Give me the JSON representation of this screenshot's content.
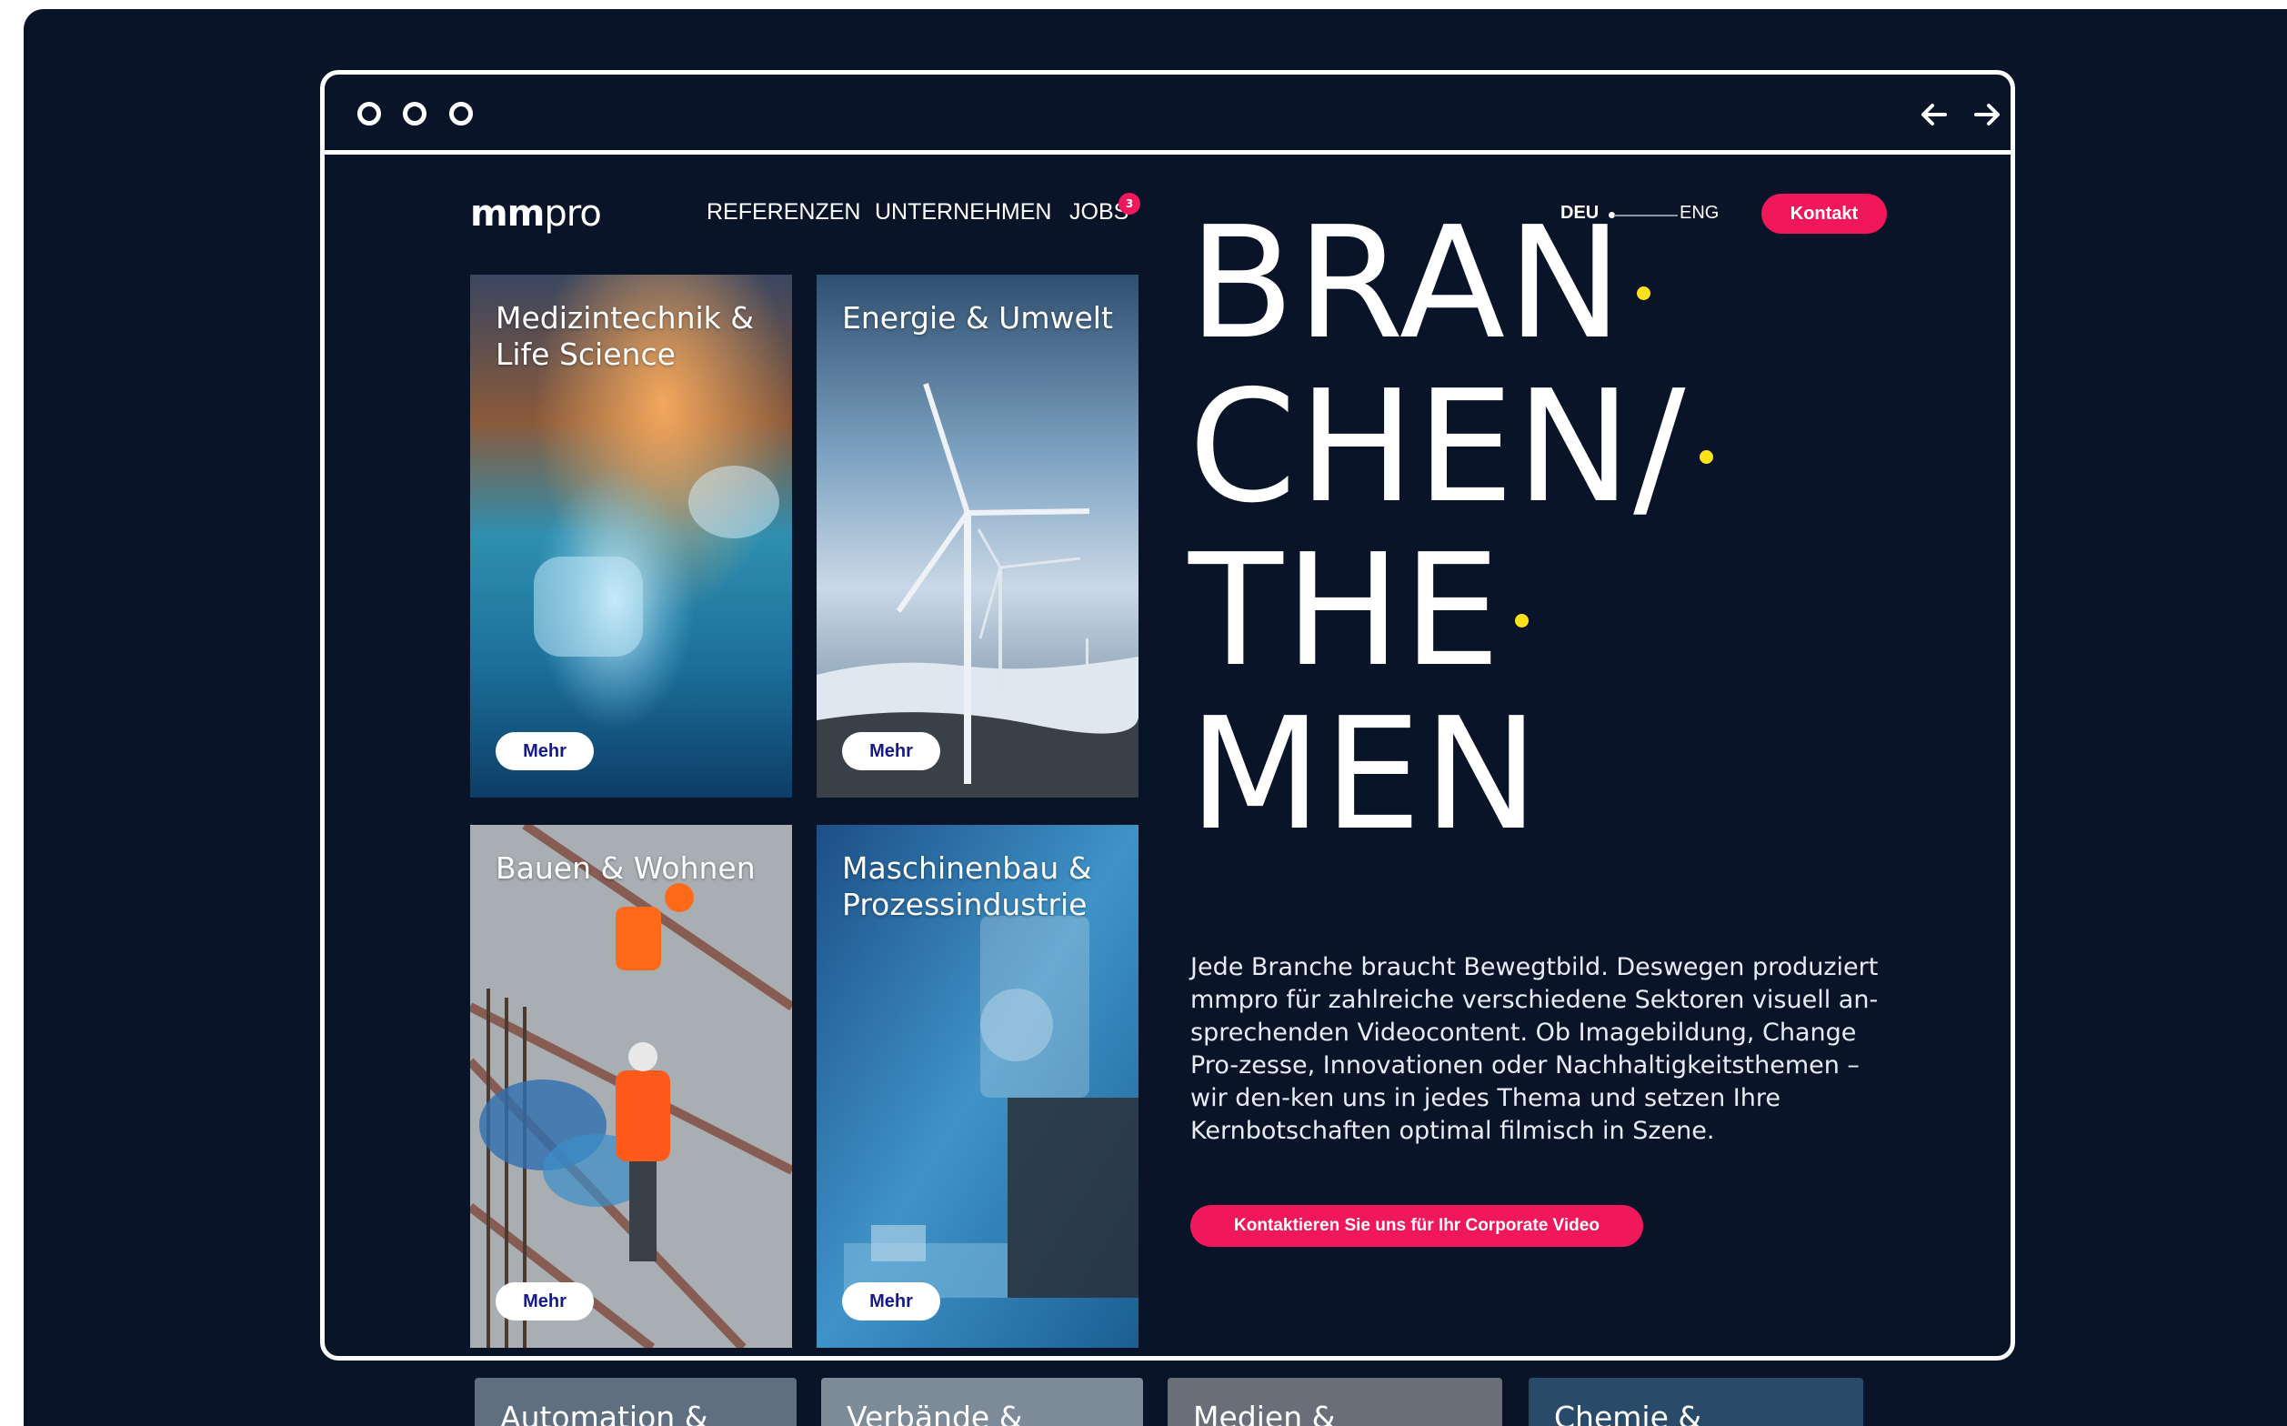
{
  "nav": {
    "logo_light": "mm",
    "logo_rest": "pro",
    "menu": [
      "REFERENZEN",
      "UNTERNEHMEN",
      "JOBS"
    ],
    "jobs_badge": "3",
    "lang_active": "DEU",
    "lang_other": "ENG",
    "contact_label": "Kontakt"
  },
  "cards": [
    {
      "title": "Medizintechnik &\nLife Science",
      "button": "Mehr"
    },
    {
      "title": "Energie & Umwelt",
      "button": "Mehr"
    },
    {
      "title": "Bauen & Wohnen",
      "button": "Mehr"
    },
    {
      "title": "Maschinenbau &\nProzessindustrie",
      "button": "Mehr"
    }
  ],
  "peek_cards": [
    "Automation &",
    "Verbände &",
    "Medien &",
    "Chemie &"
  ],
  "headline": [
    "BRAN",
    "CHEN/",
    "THE",
    "MEN"
  ],
  "paragraph": "Jede Branche braucht Bewegtbild. Deswegen produziert mmpro für zahlreiche verschiedene Sektoren visuell an-sprechenden Videocontent. Ob Imagebildung, Change Pro-zesse, Innovationen oder Nachhaltigkeitsthemen – wir den-ken uns in jedes Thema und setzen Ihre Kernbotschaften optimal filmisch in Szene.",
  "cta_label": "Kontaktieren Sie uns für Ihr Corporate Video",
  "colors": {
    "background": "#0a1428",
    "accent": "#f0185a",
    "dot": "#ffe11a",
    "button_text": "#141a8c"
  },
  "icons": [
    "window-dot-icon",
    "arrow-left-icon",
    "arrow-right-icon"
  ]
}
